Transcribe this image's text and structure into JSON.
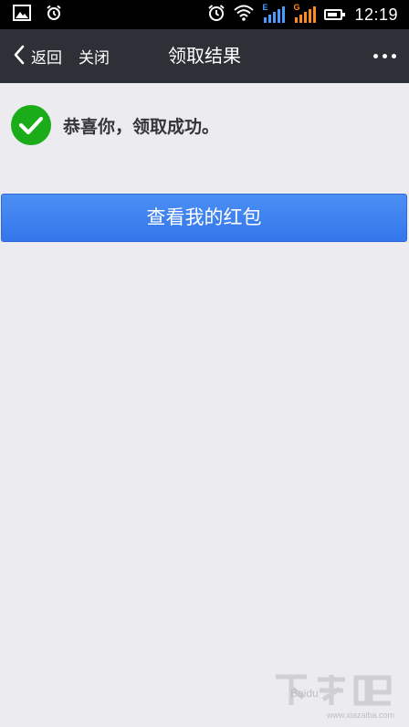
{
  "status_bar": {
    "time": "12:19",
    "sim1_network": "E",
    "sim2_network": "G",
    "sim1_color": "#4a9cff",
    "sim2_color": "#ff8a1d"
  },
  "nav": {
    "back_label": "返回",
    "close_label": "关闭",
    "title": "领取结果"
  },
  "result": {
    "message": "恭喜你，领取成功。"
  },
  "actions": {
    "view_packet_label": "查看我的红包"
  },
  "watermark": {
    "bd_text": "Baidu",
    "site": "www.xiazaiba.com"
  },
  "colors": {
    "nav_bg": "#2e3037",
    "page_bg": "#ebebf0",
    "success_green": "#1aad19",
    "button_blue": "#3d82f0"
  }
}
